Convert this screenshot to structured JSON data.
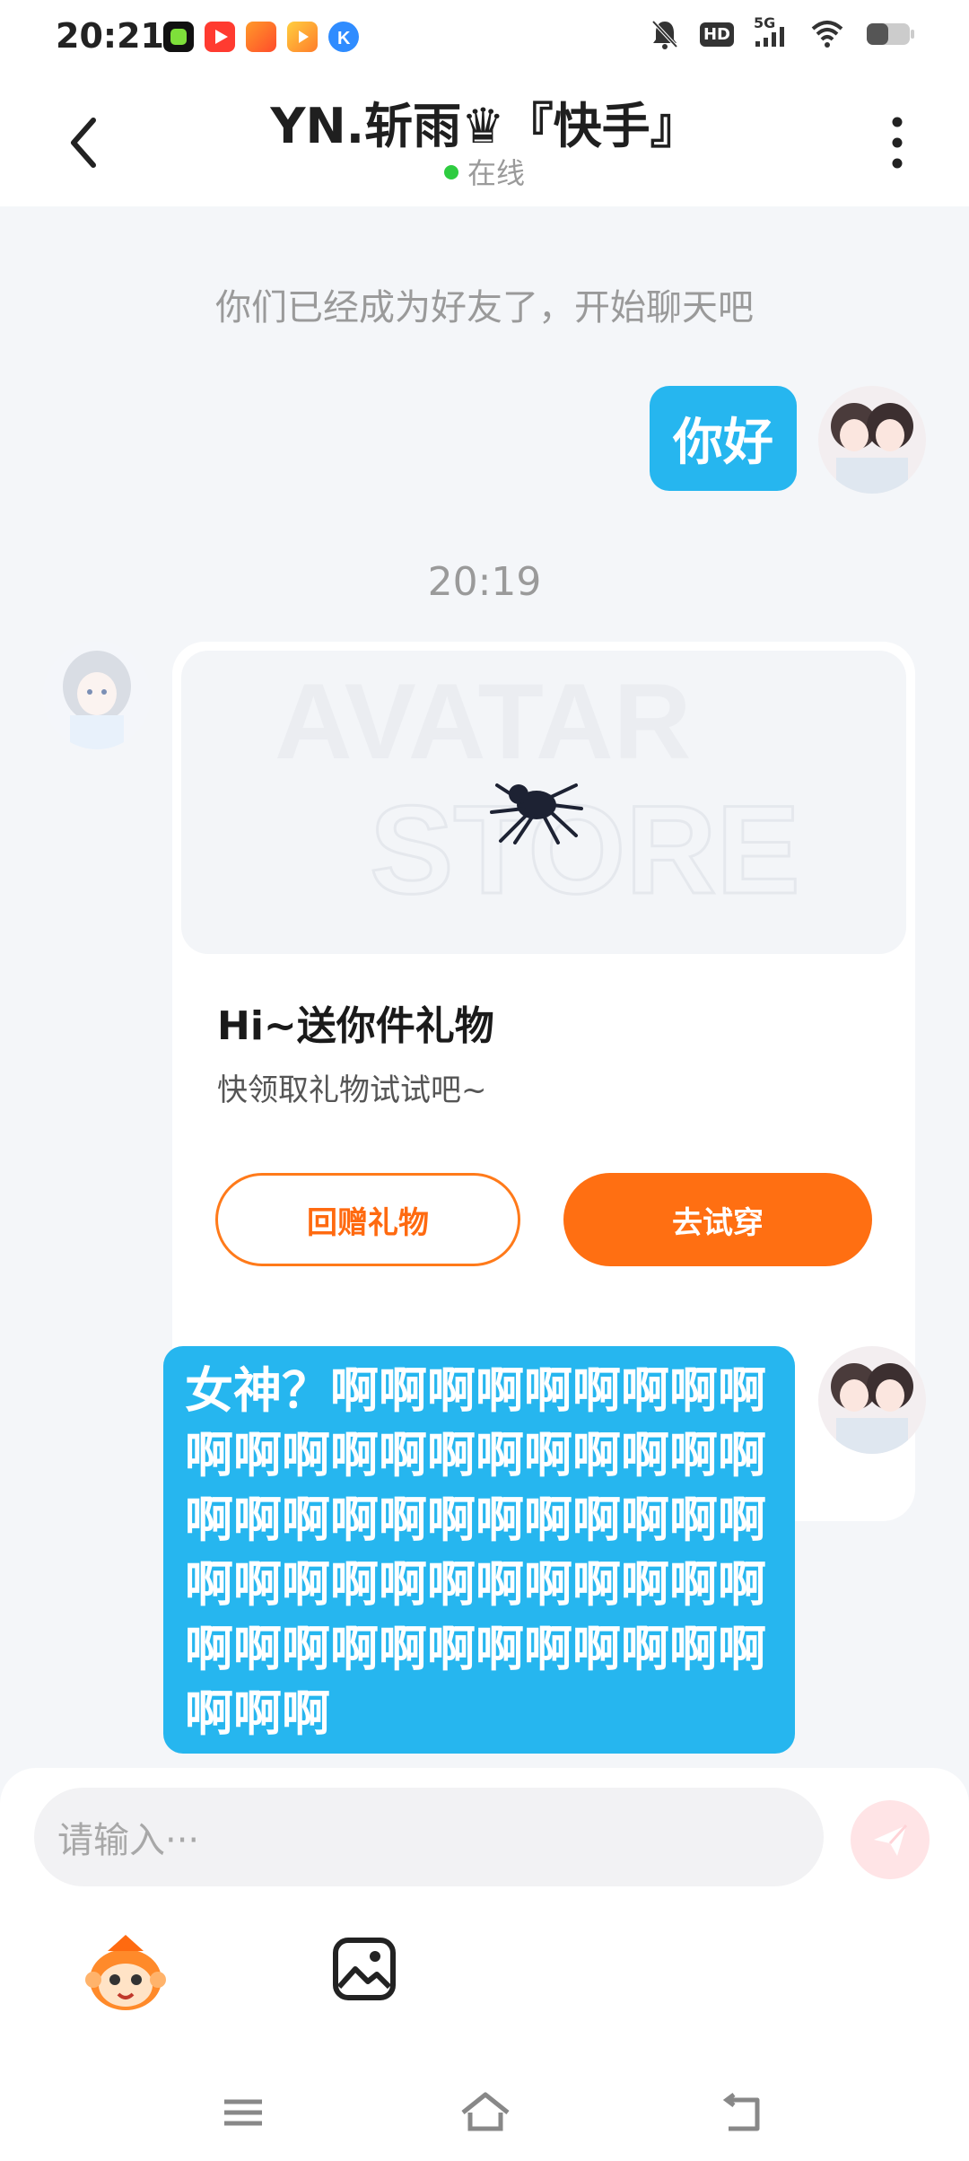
{
  "status_bar": {
    "time": "20:21",
    "app_icons": [
      {
        "name": "notification-app-icon",
        "color": "#2ecc40"
      },
      {
        "name": "video-app-icon",
        "color": "#ff3b30"
      },
      {
        "name": "shopping-app-icon",
        "color": "#ff7f2a"
      },
      {
        "name": "store-app-icon",
        "color": "#ffb020"
      },
      {
        "name": "kuaishou-k-icon",
        "color": "#2f8cff"
      }
    ],
    "system_icons": [
      "mute-bell-icon",
      "hd-icon",
      "5g-signal-icon",
      "wifi-icon",
      "battery-icon"
    ],
    "network_label": "5G",
    "hd_label": "HD"
  },
  "header": {
    "title": "YN.斩雨♛『快手』",
    "presence": "在线",
    "presence_color": "#2ecc40"
  },
  "chat": {
    "system_note": "你们已经成为好友了，开始聊天吧",
    "messages": [
      {
        "from": "me",
        "text": "你好"
      },
      {
        "timestamp": "20:19"
      },
      {
        "from": "other",
        "type": "gift-card"
      },
      {
        "from": "me",
        "text": "女神？啊啊啊啊啊啊啊啊啊啊啊啊啊啊啊啊啊啊啊啊啊啊啊啊啊啊啊啊啊啊啊啊啊啊啊啊啊啊啊啊啊啊啊啊啊啊啊啊啊啊啊啊啊啊啊啊啊啊啊啊"
      }
    ],
    "first_message": "你好",
    "timestamp": "20:19",
    "long_message": "女神？啊啊啊啊啊啊啊啊啊啊啊啊啊啊啊啊啊啊啊啊啊啊啊啊啊啊啊啊啊啊啊啊啊啊啊啊啊啊啊啊啊啊啊啊啊啊啊啊啊啊啊啊啊啊啊啊啊啊啊啊"
  },
  "gift_card": {
    "banner_watermark_line1": "AVATAR",
    "banner_watermark_line2": "STORE",
    "title": "Hi~送你件礼物",
    "subtitle": "快领取礼物试试吧~",
    "return_gift_label": "回赠礼物",
    "try_on_label": "去试穿"
  },
  "input_bar": {
    "placeholder": "请输入···"
  },
  "colors": {
    "accent_blue": "#26b6ef",
    "accent_orange": "#ff6f12",
    "background": "#f4f6f9"
  },
  "icons": {
    "back": "chevron-left-icon",
    "more": "more-vertical-icon",
    "send": "send-plane-icon",
    "mascot": "kuaishou-mascot-icon",
    "image": "image-picker-icon",
    "nav_menu": "menu-lines-icon",
    "nav_home": "home-icon",
    "nav_back": "back-arrow-icon"
  }
}
